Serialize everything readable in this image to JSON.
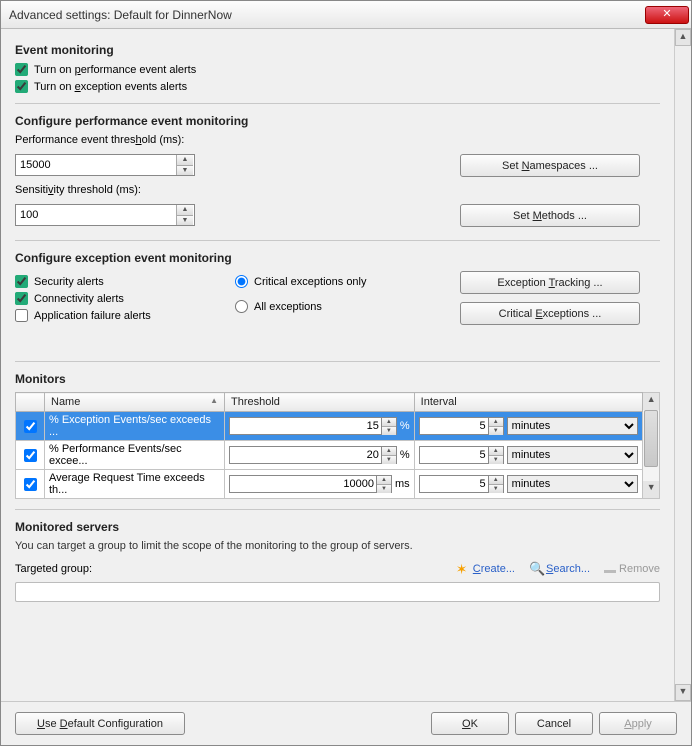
{
  "window": {
    "title": "Advanced settings: Default for DinnerNow"
  },
  "event_monitoring": {
    "heading": "Event monitoring",
    "perf_alerts_pre": "Turn on ",
    "perf_alerts_u": "p",
    "perf_alerts_post": "erformance event alerts",
    "perf_alerts_checked": true,
    "exc_alerts_pre": "Turn on ",
    "exc_alerts_u": "e",
    "exc_alerts_post": "xception events alerts",
    "exc_alerts_checked": true
  },
  "perf_config": {
    "heading": "Configure performance event monitoring",
    "threshold_label_pre": "Performance event thres",
    "threshold_label_u": "h",
    "threshold_label_post": "old (ms):",
    "threshold_value": "15000",
    "sensitivity_label_pre": "Sensiti",
    "sensitivity_label_u": "v",
    "sensitivity_label_post": "ity threshold (ms):",
    "sensitivity_value": "100",
    "btn_namespaces_pre": "Set ",
    "btn_namespaces_u": "N",
    "btn_namespaces_post": "amespaces ...",
    "btn_methods_pre": "Set ",
    "btn_methods_u": "M",
    "btn_methods_post": "ethods ..."
  },
  "exc_config": {
    "heading": "Configure exception event monitoring",
    "security_label": "Security alerts",
    "security_checked": true,
    "connectivity_label": "Connectivity alerts",
    "connectivity_checked": true,
    "appfail_label": "Application failure alerts",
    "appfail_checked": false,
    "radio_critical": "Critical exceptions only",
    "radio_all": "All exceptions",
    "radio_selected": "critical",
    "btn_tracking_pre": "Exception ",
    "btn_tracking_u": "T",
    "btn_tracking_post": "racking ...",
    "btn_critical_pre": "Critical ",
    "btn_critical_u": "E",
    "btn_critical_post": "xceptions ..."
  },
  "monitors": {
    "heading": "Monitors",
    "columns": {
      "name": "Name",
      "threshold": "Threshold",
      "interval": "Interval"
    },
    "rows": [
      {
        "checked": true,
        "name": "% Exception Events/sec exceeds ...",
        "threshold": "15",
        "threshold_unit": "%",
        "interval": "5",
        "interval_unit": "minutes",
        "selected": true
      },
      {
        "checked": true,
        "name": "% Performance Events/sec excee...",
        "threshold": "20",
        "threshold_unit": "%",
        "interval": "5",
        "interval_unit": "minutes",
        "selected": false
      },
      {
        "checked": true,
        "name": "Average Request Time exceeds th...",
        "threshold": "10000",
        "threshold_unit": "ms",
        "interval": "5",
        "interval_unit": "minutes",
        "selected": false
      }
    ]
  },
  "servers": {
    "heading": "Monitored servers",
    "note": "You can target a group to limit the scope of the monitoring to the group of servers.",
    "targeted_label": "Targeted group:",
    "create_u": "C",
    "create_post": "reate...",
    "search_u": "S",
    "search_post": "earch...",
    "remove": "Remove"
  },
  "footer": {
    "use_default": "Use Default Configuration",
    "ok_u": "O",
    "ok_post": "K",
    "cancel": "Cancel",
    "apply_u": "A",
    "apply_post": "pply"
  }
}
